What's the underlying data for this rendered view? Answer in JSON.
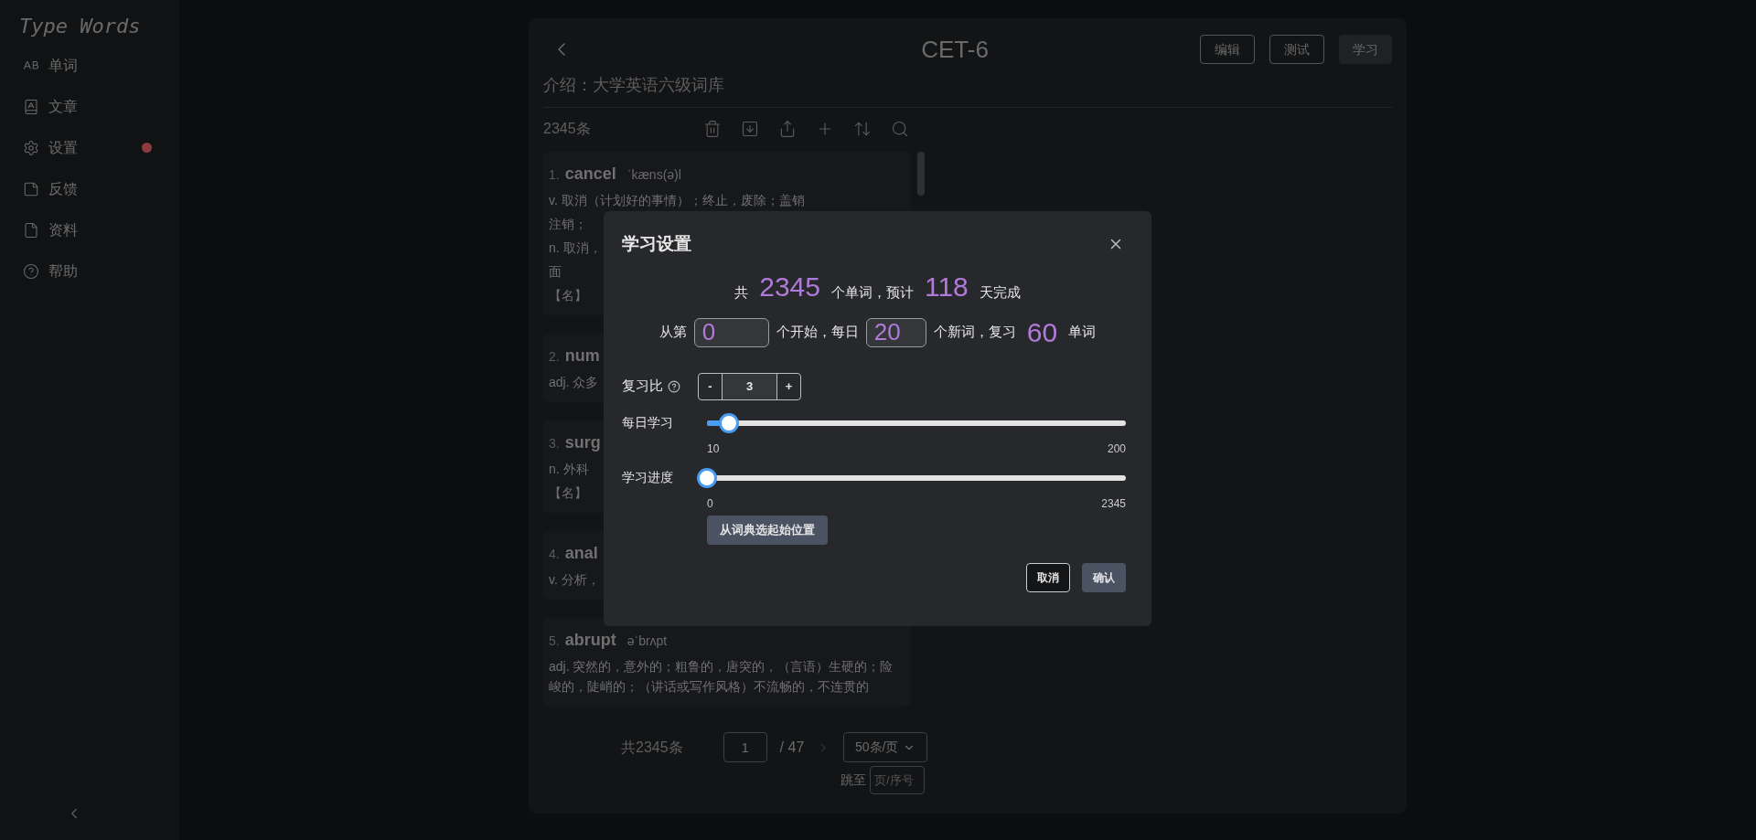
{
  "sidebar": {
    "logo": "Type Words",
    "items": [
      {
        "label": "单词",
        "notification": false
      },
      {
        "label": "文章",
        "notification": false
      },
      {
        "label": "设置",
        "notification": true
      },
      {
        "label": "反馈",
        "notification": false
      },
      {
        "label": "资料",
        "notification": false
      },
      {
        "label": "帮助",
        "notification": false
      }
    ]
  },
  "header": {
    "title": "CET-6",
    "description": "介绍：大学英语六级词库",
    "buttons": [
      {
        "label": "编辑",
        "primary": false
      },
      {
        "label": "测试",
        "primary": false
      },
      {
        "label": "学习",
        "primary": true
      }
    ]
  },
  "list": {
    "count": "2345条",
    "words": [
      {
        "index": "1.",
        "word": "cancel",
        "phonetic": "ˈkæns(ə)l",
        "lines": [
          "v. 取消（计划好的事情）；终止，废除；盖销",
          "注销；",
          "n. 取消，",
          "面",
          "【名】"
        ]
      },
      {
        "index": "2.",
        "word": "num",
        "lines": [
          "adj. 众多"
        ]
      },
      {
        "index": "3.",
        "word": "surg",
        "lines": [
          "n. 外科",
          "【名】"
        ]
      },
      {
        "index": "4.",
        "word": "anal",
        "lines": [
          "v. 分析，"
        ]
      },
      {
        "index": "5.",
        "word": "abrupt",
        "phonetic": "əˈbrʌpt",
        "lines": [
          "adj. 突然的，意外的；粗鲁的，唐突的，（言语）生硬的；险峻的，陡峭的；（讲话或写作风格）不流畅的，不连贯的"
        ]
      }
    ]
  },
  "pagination": {
    "total": "共2345条",
    "page": "1",
    "pages": "/ 47",
    "page_size": "50条/页",
    "jump_label": "跳至",
    "jump_placeholder": "页/序号"
  },
  "modal": {
    "title": "学习设置",
    "summary": [
      {
        "kind": "text",
        "text": "共"
      },
      {
        "kind": "number",
        "text": "2345"
      },
      {
        "kind": "text",
        "text": "个单词，预计"
      },
      {
        "kind": "number",
        "text": "118"
      },
      {
        "kind": "text",
        "text": "天完成"
      }
    ],
    "plan": [
      {
        "kind": "text",
        "text": "从第"
      },
      {
        "kind": "input",
        "text": "0"
      },
      {
        "kind": "text",
        "text": "个开始，每日"
      },
      {
        "kind": "input",
        "text": "20"
      },
      {
        "kind": "text",
        "text": "个新词，复习"
      },
      {
        "kind": "number",
        "text": "60"
      },
      {
        "kind": "text",
        "text": "单词"
      }
    ],
    "ratio": {
      "label": "复习比",
      "minus": "-",
      "value": "3",
      "plus": "+"
    },
    "sliders": [
      {
        "label": "每日学习",
        "level": 0.053,
        "min_label": "10",
        "max_label": "200"
      },
      {
        "label": "学习进度",
        "level": 0,
        "min_label": "0",
        "max_label": "2345"
      }
    ],
    "pick_button": "从词典选起始位置",
    "buttons": [
      {
        "label": "取消",
        "primary": false
      },
      {
        "label": "确认",
        "primary": true
      }
    ]
  }
}
